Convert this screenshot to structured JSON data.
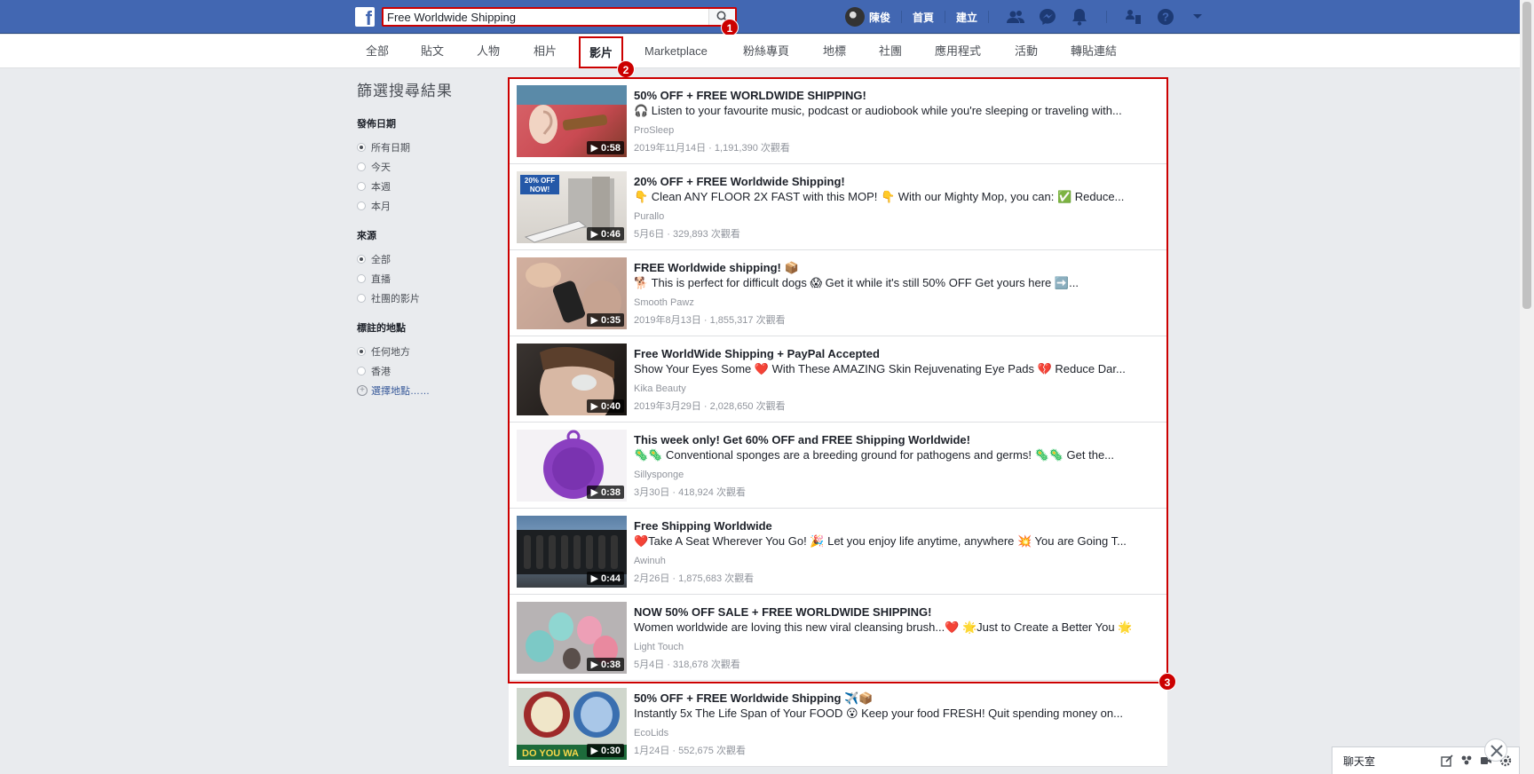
{
  "header": {
    "logo": "f",
    "search_value": "Free Worldwide Shipping",
    "user_name": "陳俊",
    "home_label": "首頁",
    "create_label": "建立"
  },
  "markers": [
    "1",
    "2",
    "3"
  ],
  "tabs": [
    "全部",
    "貼文",
    "人物",
    "相片",
    "影片",
    "Marketplace",
    "粉絲專頁",
    "地標",
    "社團",
    "應用程式",
    "活動",
    "轉貼連結"
  ],
  "active_tab": "影片",
  "sidebar": {
    "title": "篩選搜尋結果",
    "groups": [
      {
        "title": "發佈日期",
        "items": [
          "所有日期",
          "今天",
          "本週",
          "本月"
        ],
        "selected": 0
      },
      {
        "title": "來源",
        "items": [
          "全部",
          "直播",
          "社團的影片"
        ],
        "selected": 0
      },
      {
        "title": "標註的地點",
        "items": [
          "任何地方",
          "香港"
        ],
        "selected": 0
      }
    ],
    "choose_location": "選擇地點……"
  },
  "results": [
    {
      "title": "50% OFF + FREE WORLDWIDE SHIPPING!",
      "desc": "🎧 Listen to your favourite music, podcast or audiobook while you're sleeping or traveling with...",
      "source": "ProSleep",
      "meta": "2019年11月14日 · 1,191,390 次觀看",
      "duration": "0:58"
    },
    {
      "title": "20% OFF + FREE Worldwide Shipping!",
      "desc": "👇 Clean ANY FLOOR 2X FAST with this MOP! 👇 With our Mighty Mop, you can: ✅ Reduce...",
      "source": "Purallo",
      "meta": "5月6日 · 329,893 次觀看",
      "duration": "0:46"
    },
    {
      "title": "FREE Worldwide shipping! 📦",
      "desc": "🐕 This is perfect for difficult dogs 😱 Get it while it's still 50% OFF Get yours here ➡️...",
      "source": "Smooth Pawz",
      "meta": "2019年8月13日 · 1,855,317 次觀看",
      "duration": "0:35"
    },
    {
      "title": "Free WorldWide Shipping + PayPal Accepted",
      "desc": "Show Your Eyes Some ❤️ With These AMAZING Skin Rejuvenating Eye Pads 💔 Reduce Dar...",
      "source": "Kika Beauty",
      "meta": "2019年3月29日 · 2,028,650 次觀看",
      "duration": "0:40"
    },
    {
      "title": "This week only! Get 60% OFF and FREE Shipping Worldwide!",
      "desc": "🦠🦠 Conventional sponges are a breeding ground for pathogens and germs! 🦠🦠 Get the...",
      "source": "Sillysponge",
      "meta": "3月30日 · 418,924 次觀看",
      "duration": "0:38"
    },
    {
      "title": "Free Shipping Worldwide",
      "desc": "❤️Take A Seat Wherever You Go! 🎉 Let you enjoy life anytime, anywhere 💥 You are Going T...",
      "source": "Awinuh",
      "meta": "2月26日 · 1,875,683 次觀看",
      "duration": "0:44"
    },
    {
      "title": "NOW 50% OFF SALE + FREE WORLDWIDE SHIPPING!",
      "desc": "Women worldwide are loving this new viral cleansing brush...❤️ 🌟Just to Create a Better You 🌟",
      "source": "Light Touch",
      "meta": "5月4日 · 318,678 次觀看",
      "duration": "0:38"
    },
    {
      "title": "50% OFF + FREE Worldwide Shipping ✈️📦",
      "desc": "Instantly 5x The Life Span of Your FOOD 😮 Keep your food FRESH! Quit spending money on...",
      "source": "EcoLids",
      "meta": "1月24日 · 552,675 次觀看",
      "duration": "0:30"
    }
  ],
  "thumb_texts": {
    "mop_badge": "20% OFF NOW!",
    "ecolids_caption": "DO YOU WA"
  },
  "chat": {
    "label": "聊天室"
  }
}
